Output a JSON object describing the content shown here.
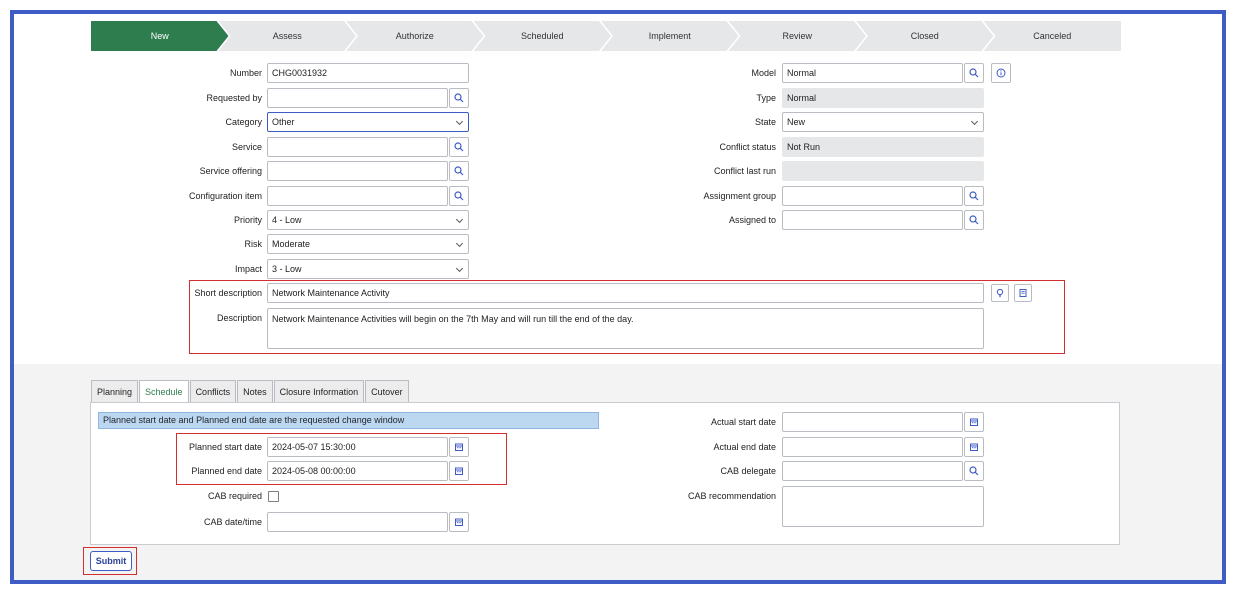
{
  "stages": [
    "New",
    "Assess",
    "Authorize",
    "Scheduled",
    "Implement",
    "Review",
    "Closed",
    "Canceled"
  ],
  "left_fields": {
    "number": {
      "label": "Number",
      "value": "CHG0031932"
    },
    "requested_by": {
      "label": "Requested by",
      "value": ""
    },
    "category": {
      "label": "Category",
      "value": "Other"
    },
    "service": {
      "label": "Service",
      "value": ""
    },
    "service_offering": {
      "label": "Service offering",
      "value": ""
    },
    "configuration_item": {
      "label": "Configuration item",
      "value": ""
    },
    "priority": {
      "label": "Priority",
      "value": "4 - Low"
    },
    "risk": {
      "label": "Risk",
      "value": "Moderate"
    },
    "impact": {
      "label": "Impact",
      "value": "3 - Low"
    }
  },
  "right_fields": {
    "model": {
      "label": "Model",
      "value": "Normal"
    },
    "type": {
      "label": "Type",
      "value": "Normal"
    },
    "state": {
      "label": "State",
      "value": "New"
    },
    "conflict_status": {
      "label": "Conflict status",
      "value": "Not Run"
    },
    "conflict_last_run": {
      "label": "Conflict last run",
      "value": ""
    },
    "assignment_group": {
      "label": "Assignment group",
      "value": ""
    },
    "assigned_to": {
      "label": "Assigned to",
      "value": ""
    }
  },
  "short_description": {
    "label": "Short description",
    "value": "Network Maintenance Activity"
  },
  "description": {
    "label": "Description",
    "value": "Network Maintenance Activities will begin on the 7th May and will run till the end of the day."
  },
  "tabs": [
    "Planning",
    "Schedule",
    "Conflicts",
    "Notes",
    "Closure Information",
    "Cutover"
  ],
  "active_tab": "Schedule",
  "schedule": {
    "info": "Planned start date and Planned end date are the requested change window",
    "planned_start": {
      "label": "Planned start date",
      "value": "2024-05-07 15:30:00"
    },
    "planned_end": {
      "label": "Planned end date",
      "value": "2024-05-08 00:00:00"
    },
    "cab_required": {
      "label": "CAB required",
      "checked": false
    },
    "cab_datetime": {
      "label": "CAB date/time",
      "value": ""
    },
    "actual_start": {
      "label": "Actual start date",
      "value": ""
    },
    "actual_end": {
      "label": "Actual end date",
      "value": ""
    },
    "cab_delegate": {
      "label": "CAB delegate",
      "value": ""
    },
    "cab_recommendation": {
      "label": "CAB recommendation",
      "value": ""
    }
  },
  "submit_label": "Submit",
  "colors": {
    "accent": "#2e7d4f",
    "frame": "#3f5bc4",
    "highlight": "#d32f2f"
  }
}
